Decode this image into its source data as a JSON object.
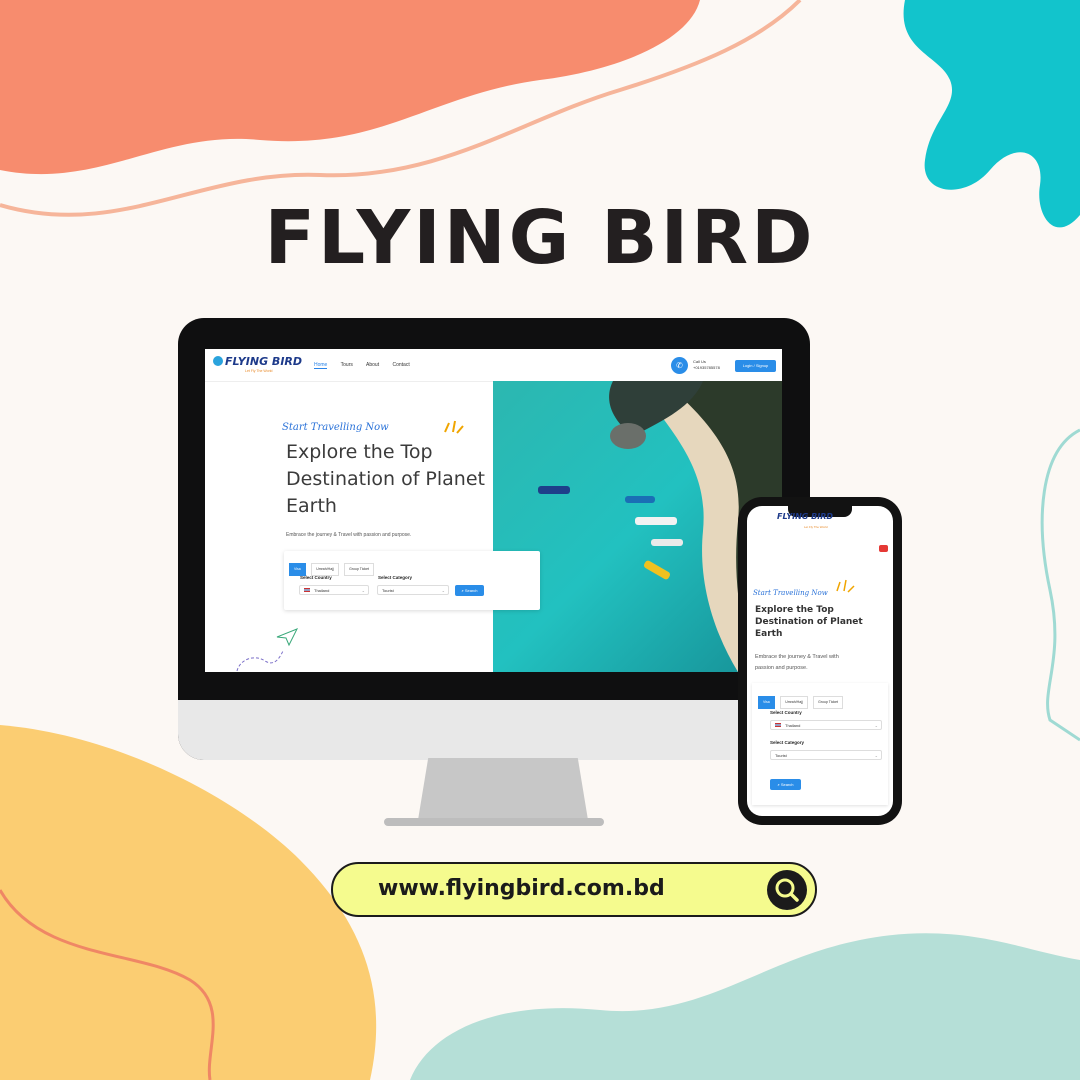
{
  "brand_title": "FLYING BIRD",
  "url": "www.flyingbird.com.bd",
  "colors": {
    "coral": "#f78c6e",
    "teal": "#12c4cc",
    "yellow": "#fbcd72",
    "mint": "#b5dfd7",
    "pill": "#f5fb8e",
    "accent": "#2a8de8"
  },
  "site": {
    "logo_text": "FLYING BIRD",
    "tagline": "Let Fly The World",
    "nav": [
      "Home",
      "Tours",
      "About",
      "Contact"
    ],
    "call_label": "Call Us",
    "call_number": "+01935785578",
    "login_label": "Login / Signup",
    "hero_script": "Start Travelling Now",
    "hero_title": "Explore the Top Destination of Planet Earth",
    "hero_sub": "Embrace the journey & Travel with passion and purpose.",
    "tabs": [
      "Visa",
      "Umrah/Hajj",
      "Group Ticket"
    ],
    "country_label": "Select Country",
    "country_value": "Thailand",
    "category_label": "Select Category",
    "category_value": "Tourist",
    "search_label": "Search"
  },
  "icons": [
    "phone-icon",
    "search-icon",
    "chevron-down-icon",
    "paper-plane-icon",
    "youtube-icon"
  ]
}
